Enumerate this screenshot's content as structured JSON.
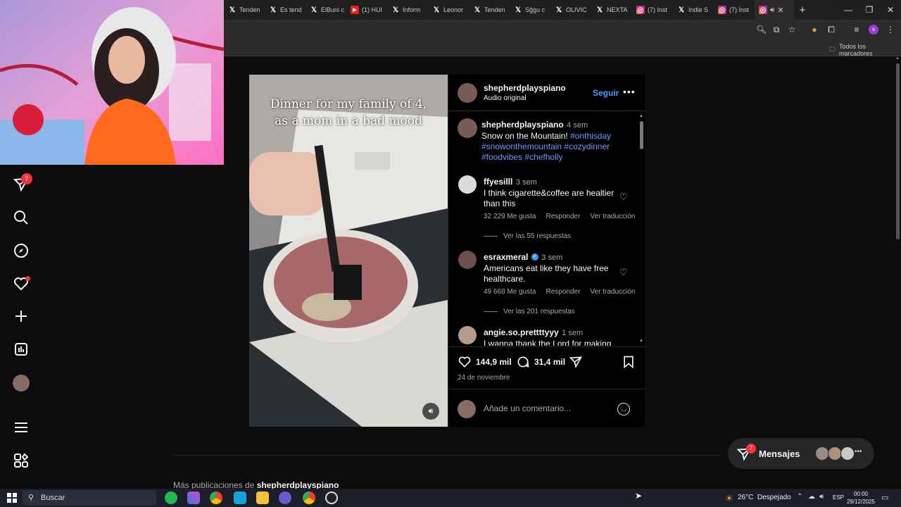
{
  "browser": {
    "tabs": [
      {
        "label": "Tenden",
        "icon": "x-icon"
      },
      {
        "label": "Es tend",
        "icon": "x-icon"
      },
      {
        "label": "ElBuni c",
        "icon": "x-icon"
      },
      {
        "label": "(1) HUI",
        "icon": "youtube-icon"
      },
      {
        "label": "Inform",
        "icon": "x-icon"
      },
      {
        "label": "Leonor",
        "icon": "x-icon"
      },
      {
        "label": "Tenden",
        "icon": "x-icon"
      },
      {
        "label": "Sĝgu c",
        "icon": "x-icon"
      },
      {
        "label": "OLIVIC",
        "icon": "x-icon"
      },
      {
        "label": "NEXTA",
        "icon": "x-icon"
      },
      {
        "label": "(7) Inst",
        "icon": "instagram-icon"
      },
      {
        "label": "Indie S",
        "icon": "x-icon"
      },
      {
        "label": "(7) Inst",
        "icon": "instagram-icon"
      }
    ],
    "active_tab_icon": "instagram-icon",
    "bookmarks_label": "Todos los marcadores",
    "profile_initial": "s"
  },
  "nav": {
    "notif_badge": "7"
  },
  "video": {
    "caption_line1": "Dinner for my family of 4,",
    "caption_line2": "as a mom in a bad mood"
  },
  "post": {
    "author": "shepherdplayspiano",
    "audio": "Audio original",
    "follow": "Seguir",
    "caption_user": "shepherdplayspiano",
    "caption_time": "4 sem",
    "caption_text": "Snow on the Mountain! ",
    "caption_tags1": "#onthisday",
    "caption_tags2": "#snowonthemountain #cozydinner",
    "caption_tags3": "#foodvibes #chefholly",
    "comments": [
      {
        "user": "ffyesilll",
        "time": "3 sem",
        "text1": "I think cigarette&coffee are healtier",
        "text2": "than this",
        "likes": "32 229 Me gusta",
        "reply": "Responder",
        "translate": "Ver traducción",
        "replies": "Ver las 55 respuestas"
      },
      {
        "user": "esraxmeral",
        "time": "3 sem",
        "text1": "Americans eat like they have free",
        "text2": "healthcare.",
        "likes": "49 668 Me gusta",
        "reply": "Responder",
        "translate": "Ver traducción",
        "replies": "Ver las 201 respuestas"
      },
      {
        "user": "angie.so.prettttyyy",
        "time": "1 sem",
        "text1": "I wanna thank the Lord for making",
        "text2": ""
      }
    ],
    "like_count": "144,9 mil",
    "comment_count": "31,4 mil",
    "date": "24 de noviembre",
    "add_comment_placeholder": "Añade un comentario..."
  },
  "more_posts": {
    "prefix": "Más publicaciones de ",
    "user": "shepherdplayspiano"
  },
  "messages": {
    "label": "Mensajes",
    "badge": "7"
  },
  "taskbar": {
    "search": "Buscar",
    "weather": "26°C  Despejado",
    "lang": "ESP",
    "time": "00:00",
    "date": "29/12/2025"
  }
}
